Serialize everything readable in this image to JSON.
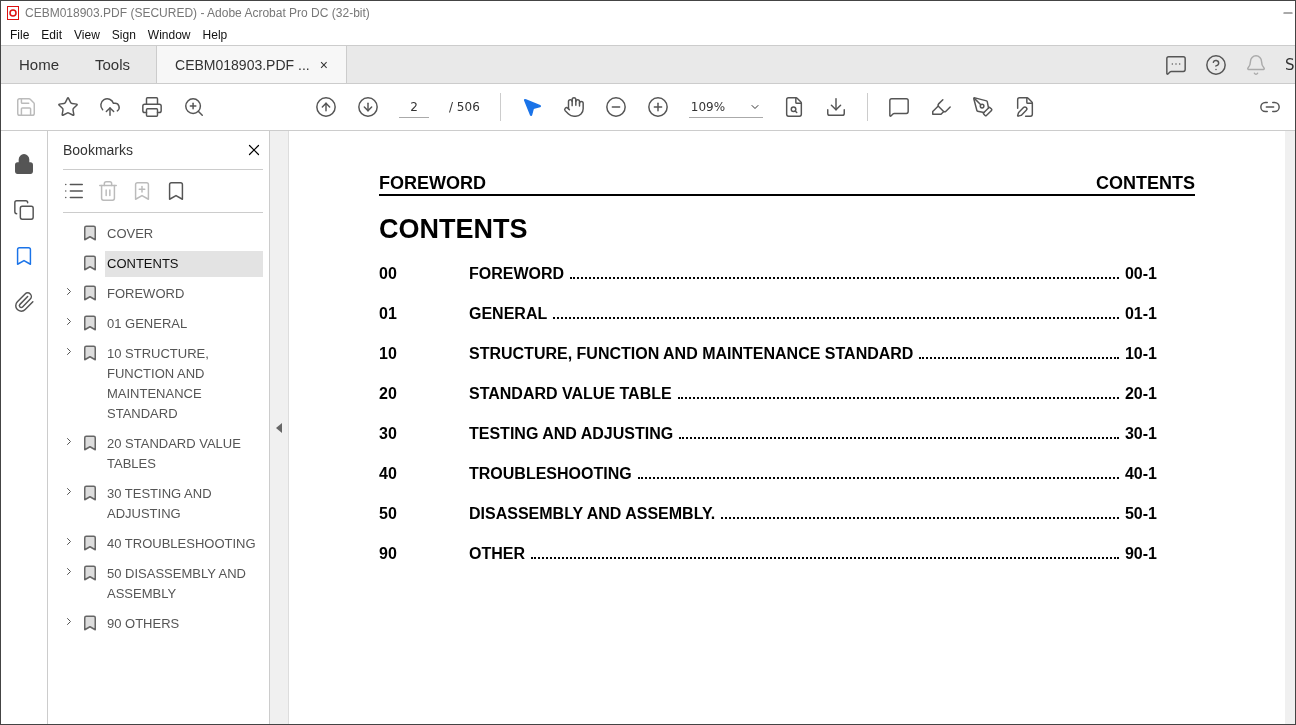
{
  "window": {
    "title": "CEBM018903.PDF (SECURED) - Adobe Acrobat Pro DC (32-bit)"
  },
  "menu": [
    "File",
    "Edit",
    "View",
    "Sign",
    "Window",
    "Help"
  ],
  "tabs": [
    {
      "label": "Home",
      "selected": false
    },
    {
      "label": "Tools",
      "selected": false
    },
    {
      "label": "CEBM018903.PDF ...",
      "selected": true,
      "close": "×"
    }
  ],
  "account_label": "S",
  "toolbar": {
    "page": "2",
    "page_total": "/ 506",
    "zoom": "109%"
  },
  "bookmarks": {
    "title": "Bookmarks",
    "items": [
      {
        "label": "COVER",
        "expandable": false,
        "selected": false
      },
      {
        "label": "CONTENTS",
        "expandable": false,
        "selected": true
      },
      {
        "label": "FOREWORD",
        "expandable": true,
        "selected": false
      },
      {
        "label": "01 GENERAL",
        "expandable": true,
        "selected": false
      },
      {
        "label": "10 STRUCTURE, FUNCTION AND MAINTENANCE STANDARD",
        "expandable": true,
        "selected": false
      },
      {
        "label": "20 STANDARD VALUE TABLES",
        "expandable": true,
        "selected": false
      },
      {
        "label": "30 TESTING AND ADJUSTING",
        "expandable": true,
        "selected": false
      },
      {
        "label": "40 TROUBLESHOOTING",
        "expandable": true,
        "selected": false
      },
      {
        "label": "50 DISASSEMBLY AND ASSEMBLY",
        "expandable": true,
        "selected": false
      },
      {
        "label": "90 OTHERS",
        "expandable": true,
        "selected": false
      }
    ]
  },
  "document": {
    "header_left": "FOREWORD",
    "header_right": "CONTENTS",
    "heading": "CONTENTS",
    "rows": [
      {
        "number": "00",
        "title": "FOREWORD",
        "page": "00-1"
      },
      {
        "number": "01",
        "title": "GENERAL",
        "page": "01-1"
      },
      {
        "number": "10",
        "title": "STRUCTURE, FUNCTION AND MAINTENANCE STANDARD",
        "page": "10-1"
      },
      {
        "number": "20",
        "title": "STANDARD VALUE TABLE",
        "page": "20-1"
      },
      {
        "number": "30",
        "title": "TESTING AND ADJUSTING",
        "page": "30-1"
      },
      {
        "number": "40",
        "title": "TROUBLESHOOTING",
        "page": "40-1"
      },
      {
        "number": "50",
        "title": "DISASSEMBLY AND ASSEMBLY.",
        "page": "50-1"
      },
      {
        "number": "90",
        "title": "OTHER",
        "page": "90-1"
      }
    ]
  }
}
